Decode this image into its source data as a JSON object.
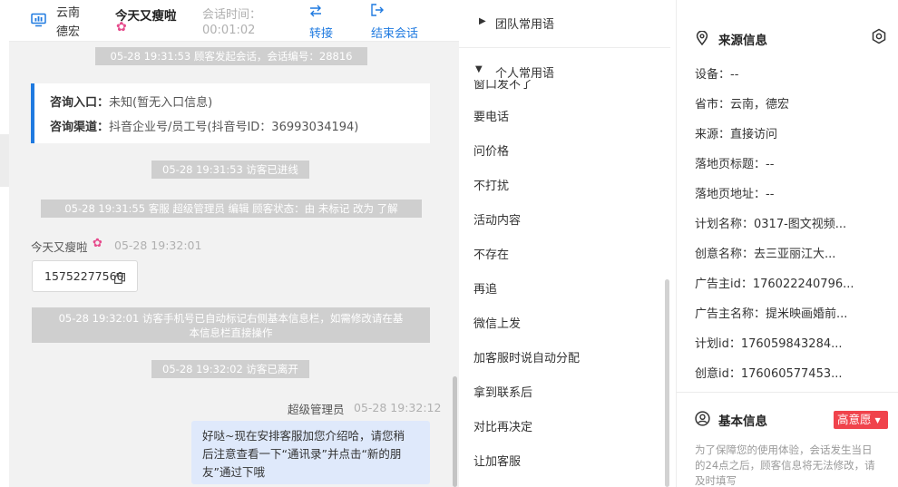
{
  "chat_header": {
    "location": "云南德宏",
    "visitor_name": "今天又瘦啦",
    "session_time_label": "会话时间：",
    "session_time_value": "00:01:02",
    "transfer_label": "转接",
    "end_label": "结束会话"
  },
  "messages": {
    "sys_start": "05-28 19:31:53 顾客发起会话，会话编号：28816",
    "entry_label": "咨询入口：",
    "entry_value": "未知(暂无入口信息)",
    "channel_label": "咨询渠道：",
    "channel_value": "抖音企业号/员工号(抖音号ID：36993034194)",
    "sys_entered": "05-28 19:31:53 访客已进线",
    "sys_edit": "05-28 19:31:55 客服 超级管理员 编辑 顾客状态：由 未标记 改为 了解",
    "visitor_name": "今天又瘦啦",
    "visitor_time": "05-28 19:32:01",
    "visitor_phone": "15752277560",
    "sys_phone_l1": "05-28 19:32:01 访客手机号已自动标记右侧基本信息栏，如需修改请在基",
    "sys_phone_l2": "本信息栏直接操作",
    "sys_left": "05-28 19:32:02 访客已离开",
    "agent_name": "超级管理员",
    "agent_time": "05-28 19:32:12",
    "agent_l1": "好哒~现在安排客服加您介绍哈，请您稍",
    "agent_l2": "后注意查看一下“通讯录”并点击“新的朋",
    "agent_l3": "友”通过下哦"
  },
  "phrases": {
    "team_title": "团队常用语",
    "personal_title": "个人常用语",
    "clipped": "窗口发不了",
    "items": [
      "要电话",
      "问价格",
      "不打扰",
      "活动内容",
      "不存在",
      "再追",
      "微信上发",
      "加客服时说自动分配",
      "拿到联系后",
      "对比再决定",
      "让加客服"
    ]
  },
  "source": {
    "title": "来源信息",
    "rows": [
      "设备：--",
      "省市：云南，德宏",
      "来源：直接访问",
      "落地页标题：--",
      "落地页地址：--",
      "计划名称：0317-图文视频...",
      "创意名称：去三亚丽江大...",
      "广告主id：176022240796...",
      "广告主名称：提米映画婚前...",
      "计划id：176059843284...",
      "创意id：176060577453..."
    ]
  },
  "basic": {
    "title": "基本信息",
    "intent_badge": "高意愿",
    "note_l1": "为了保障您的使用体验，会话发生当日",
    "note_l2": "的24点之后，顾客信息将无法修改，请",
    "note_l3": "及时填写"
  },
  "colors": {
    "accent": "#1f7ae0",
    "badge": "#f0434c",
    "system_bubble": "#cfcfcf",
    "agent_bubble": "#dfe9fb"
  }
}
